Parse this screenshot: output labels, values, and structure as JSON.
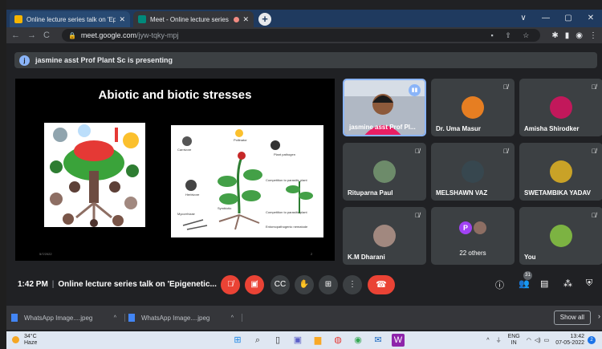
{
  "browser": {
    "tabs": [
      {
        "title": "Online lecture series talk on 'Epi...",
        "favicon_color": "#f4b400"
      },
      {
        "title": "Meet - Online lecture series",
        "favicon_color": "#00897b"
      }
    ],
    "new_tab": "+",
    "window_controls": [
      "∨",
      "—",
      "▢",
      "✕"
    ],
    "url_host": "meet.google.com",
    "url_path": "/jyw-tqky-mpj",
    "address_icons": "▪ ⇧ ☆",
    "extensions": [
      "✱",
      "▮",
      "◉",
      "⋮"
    ]
  },
  "presenting_banner": {
    "avatar_letter": "j",
    "text": "jasmine asst Prof Plant Sc is presenting"
  },
  "slide": {
    "title": "Abiotic and biotic stresses",
    "date": "5/7/2022",
    "page_number": "2",
    "fig2_labels": [
      "Carnivore",
      "Pollinator",
      "Plant pathogen",
      "Herbivore",
      "Competition to parasitic plant",
      "Mycorrhizae",
      "Symbiotic",
      "Competition to parasitic plant",
      "Entomopathogenic nematode"
    ]
  },
  "participants": [
    {
      "name": "jasmine asst Prof Pl...",
      "speaking": true,
      "muted": false
    },
    {
      "name": "Dr. Uma Masur",
      "muted": true
    },
    {
      "name": "Amisha Shirodker",
      "muted": true
    },
    {
      "name": "Rituparna Paul",
      "muted": true
    },
    {
      "name": "MELSHAWN VAZ",
      "muted": true
    },
    {
      "name": "SWETAMBIKA YADAV",
      "muted": true
    },
    {
      "name": "K.M Dharani",
      "muted": true
    },
    {
      "name": "22 others",
      "avatar_letter": "P"
    },
    {
      "name": "You",
      "muted": true
    }
  ],
  "controls": {
    "time": "1:42 PM",
    "meeting_title": "Online lecture series talk on 'Epigenetic...",
    "participant_count": "31"
  },
  "downloads": {
    "items": [
      {
        "name": "WhatsApp Image....jpeg"
      },
      {
        "name": "WhatsApp Image....jpeg"
      }
    ],
    "show_all": "Show all"
  },
  "taskbar": {
    "temperature": "34°C",
    "weather": "Haze",
    "lang_top": "ENG",
    "lang_bottom": "IN",
    "time": "13:42",
    "date": "07-05-2022",
    "notifications": "2"
  }
}
